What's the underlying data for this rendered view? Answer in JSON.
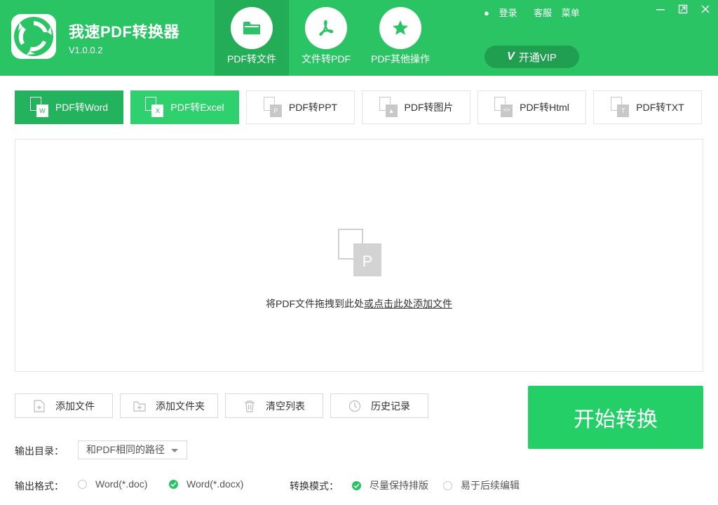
{
  "app": {
    "title": "我速PDF转换器",
    "version": "V1.0.0.2"
  },
  "nav_tabs": [
    {
      "label": "PDF转文件",
      "icon": "folder-icon",
      "active": true
    },
    {
      "label": "文件转PDF",
      "icon": "acrobat-icon",
      "active": false
    },
    {
      "label": "PDF其他操作",
      "icon": "star-icon",
      "active": false
    }
  ],
  "top_links": {
    "login": "登录",
    "service": "客服",
    "menu": "菜单"
  },
  "vip": {
    "badge": "V",
    "label": "开通VIP"
  },
  "sub_tabs": [
    {
      "label": "PDF转Word",
      "glyph": "W",
      "state": "active"
    },
    {
      "label": "PDF转Excel",
      "glyph": "X",
      "state": "hover"
    },
    {
      "label": "PDF转PPT",
      "glyph": "P",
      "state": "normal"
    },
    {
      "label": "PDF转图片",
      "glyph": "▲",
      "state": "normal"
    },
    {
      "label": "PDF转Html",
      "glyph": "</>",
      "state": "normal"
    },
    {
      "label": "PDF转TXT",
      "glyph": "T",
      "state": "normal"
    }
  ],
  "drop_zone": {
    "icon_glyph": "P",
    "text_prefix": "将PDF文件拖拽到此处",
    "text_link": "或点击此处添加文件"
  },
  "actions": {
    "add_file": "添加文件",
    "add_folder": "添加文件夹",
    "clear_list": "清空列表",
    "history": "历史记录"
  },
  "start_button": "开始转换",
  "output_dir": {
    "label": "输出目录：",
    "value": "和PDF相同的路径"
  },
  "output_format": {
    "label": "输出格式：",
    "options": [
      {
        "label": "Word(*.doc)",
        "checked": false
      },
      {
        "label": "Word(*.docx)",
        "checked": true
      }
    ]
  },
  "convert_mode": {
    "label": "转换模式：",
    "options": [
      {
        "label": "尽量保持排版",
        "checked": true
      },
      {
        "label": "易于后续编辑",
        "checked": false
      }
    ]
  },
  "colors": {
    "brand": "#2bc464",
    "brand_dark": "#24ad57",
    "start_button": "#25cf68"
  }
}
